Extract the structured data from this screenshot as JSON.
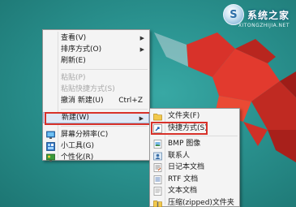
{
  "watermark": {
    "text": "系统之家",
    "logo_glyph": "S",
    "subtext": "XITONGZHIJIA.NET"
  },
  "context_menu": {
    "items": [
      {
        "label": "查看(V)",
        "has_submenu": true
      },
      {
        "label": "排序方式(O)",
        "has_submenu": true
      },
      {
        "label": "刷新(E)"
      },
      {
        "separator": true
      },
      {
        "label": "粘贴(P)",
        "disabled": true
      },
      {
        "label": "粘贴快捷方式(S)",
        "disabled": true
      },
      {
        "label": "撤消 新建(U)",
        "shortcut": "Ctrl+Z"
      },
      {
        "separator": true
      },
      {
        "label": "新建(W)",
        "has_submenu": true,
        "highlighted": true
      },
      {
        "separator": true
      },
      {
        "label": "屏幕分辨率(C)",
        "icon": "monitor-icon"
      },
      {
        "label": "小工具(G)",
        "icon": "gadgets-icon"
      },
      {
        "label": "个性化(R)",
        "icon": "personalize-icon"
      }
    ]
  },
  "submenu_new": {
    "items": [
      {
        "label": "文件夹(F)",
        "icon": "folder-icon"
      },
      {
        "label": "快捷方式(S)",
        "icon": "shortcut-icon",
        "highlighted": true
      },
      {
        "separator": true
      },
      {
        "label": "BMP 图像",
        "icon": "bitmap-icon"
      },
      {
        "label": "联系人",
        "icon": "contact-icon"
      },
      {
        "label": "日记本文档",
        "icon": "journal-icon"
      },
      {
        "label": "RTF 文档",
        "icon": "rtf-document-icon"
      },
      {
        "label": "文本文档",
        "icon": "text-document-icon"
      },
      {
        "label": "压缩(zipped)文件夹",
        "icon": "zip-folder-icon"
      }
    ]
  },
  "colors": {
    "highlight_box": "#d8322a",
    "desktop": "#2a928f",
    "menu_bg": "#f4f4f4"
  }
}
